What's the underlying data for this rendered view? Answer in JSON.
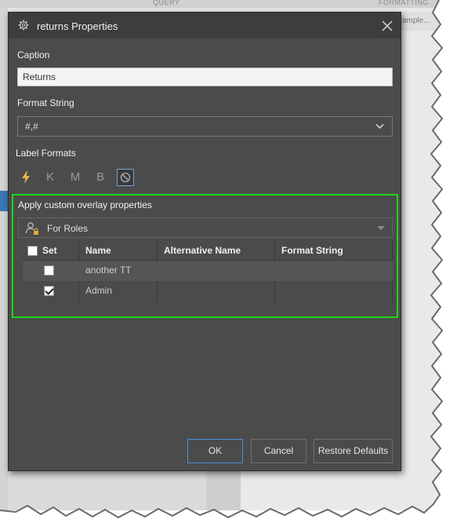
{
  "background": {
    "tabs": [
      "QUERY",
      "FORMATTING"
    ],
    "right_strip_text": "ample..."
  },
  "dialog": {
    "title": "returns Properties",
    "caption_label": "Caption",
    "caption_value": "Returns",
    "format_string_label": "Format String",
    "format_string_value": "#,#",
    "label_formats_label": "Label Formats",
    "label_format_buttons": [
      {
        "label": "",
        "icon": "lightning-icon"
      },
      {
        "label": "K"
      },
      {
        "label": "M"
      },
      {
        "label": "B"
      },
      {
        "label": "",
        "icon": "no-format-icon",
        "selected": true
      }
    ],
    "overlay_label": "Apply custom overlay properties",
    "roles_select_value": "For Roles",
    "grid": {
      "columns": [
        "Set",
        "Name",
        "Alternative Name",
        "Format String"
      ],
      "rows": [
        {
          "set": false,
          "name": "another TT",
          "alt_name": "",
          "format": ""
        },
        {
          "set": true,
          "name": "Admin",
          "alt_name": "",
          "format": ""
        }
      ]
    },
    "buttons": {
      "ok": "OK",
      "cancel": "Cancel",
      "restore": "Restore Defaults"
    }
  },
  "colors": {
    "dialog_bg": "#4b4b4b",
    "highlight_border": "#1bd61b",
    "primary_button_border": "#4a90d9"
  }
}
